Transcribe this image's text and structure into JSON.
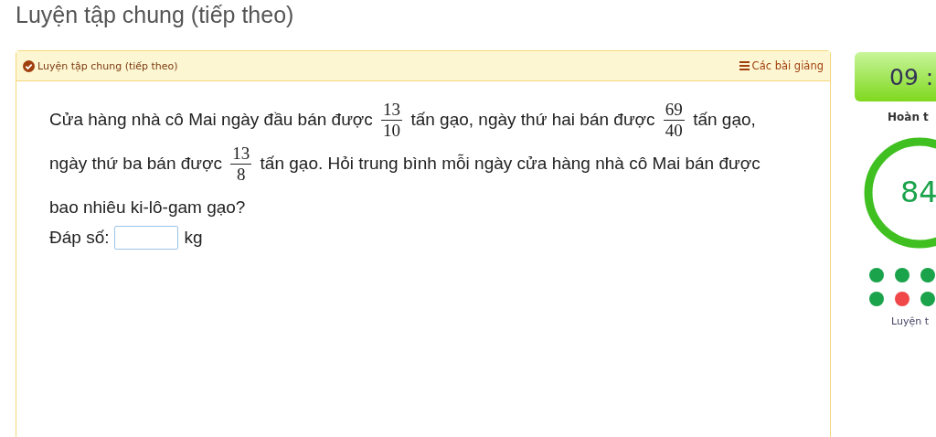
{
  "page_title": "Luyện tập chung (tiếp theo)",
  "card": {
    "header": {
      "title": "Luyện tập chung (tiếp theo)",
      "completed": true,
      "lessons_link": "Các bài giảng"
    },
    "problem": [
      {
        "kind": "text",
        "text": "Cửa hàng nhà cô Mai ngày đầu bán được"
      },
      {
        "kind": "fraction",
        "numerator": "13",
        "denominator": "10"
      },
      {
        "kind": "text",
        "text": "tấn gạo, ngày thứ hai bán được"
      },
      {
        "kind": "fraction",
        "numerator": "69",
        "denominator": "40"
      },
      {
        "kind": "text",
        "text": "tấn gạo, ngày thứ ba bán được"
      },
      {
        "kind": "fraction",
        "numerator": "13",
        "denominator": "8"
      },
      {
        "kind": "text",
        "text": "tấn gạo. Hỏi trung bình mỗi ngày cửa hàng nhà cô Mai bán được bao nhiêu ki-lô-gam gạo?"
      }
    ],
    "answer": {
      "label": "Đáp số:",
      "unit": "kg"
    }
  },
  "side": {
    "timer": "09 :",
    "progress_label": "Hoàn t",
    "progress": {
      "reading": "84"
    },
    "dots": [
      {
        "color": "#1aa34a"
      },
      {
        "color": "#1aa34a"
      },
      {
        "color": "#1aa34a"
      },
      {
        "color": "#1aa34a"
      },
      {
        "color": "#f04848"
      },
      {
        "color": "#1aa34a"
      }
    ],
    "footer": "Luyện t"
  }
}
